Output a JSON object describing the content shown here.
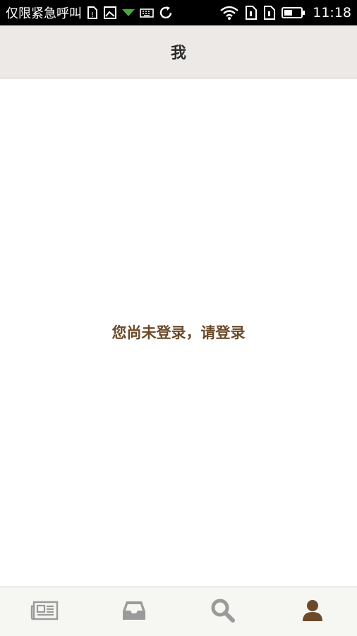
{
  "status_bar": {
    "carrier_text": "仅限紧急呼叫",
    "time": "11:18",
    "icons": [
      "sim-alert-icon",
      "image-icon",
      "download-arrow-icon",
      "keyboard-icon",
      "sync-icon",
      "wifi-icon",
      "sim1-icon",
      "sim2-icon",
      "battery-icon"
    ]
  },
  "header": {
    "title": "我"
  },
  "main": {
    "login_prompt": "您尚未登录，请登录"
  },
  "tab_bar": {
    "tabs": [
      {
        "icon": "news-icon",
        "active": false
      },
      {
        "icon": "inbox-icon",
        "active": false
      },
      {
        "icon": "search-icon",
        "active": false
      },
      {
        "icon": "profile-icon",
        "active": true
      }
    ]
  },
  "colors": {
    "accent": "#6b4a2b",
    "inactive_icon": "#9a9a9a",
    "header_bg": "#ede9e6",
    "tab_bar_bg": "#f6f6f3"
  }
}
